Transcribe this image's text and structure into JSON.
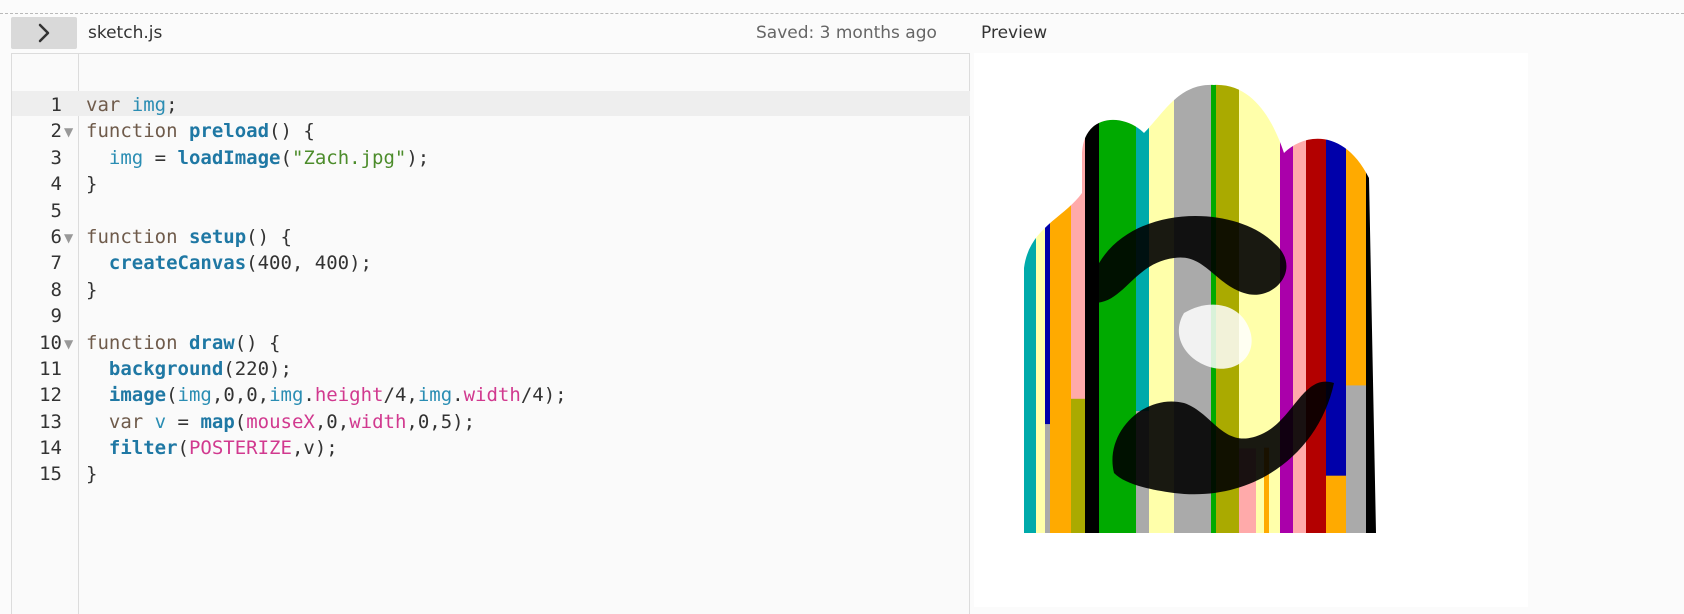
{
  "toolbar": {
    "toggle_icon": "chevron-right-icon",
    "file_name": "sketch.js",
    "saved_status": "Saved: 3 months ago",
    "preview_label": "Preview"
  },
  "colors": {
    "keyword": "#6f5b4b",
    "function_name": "#1f78a4",
    "builtin": "#1f78a4",
    "variable": "#2a8db3",
    "property": "#d1398f",
    "string": "#4c8c2b",
    "plain": "#333333"
  },
  "editor": {
    "lines": [
      {
        "number": "1",
        "fold": false,
        "tokens": [
          {
            "text": "var ",
            "type": "keyword"
          },
          {
            "text": "img",
            "type": "variable"
          },
          {
            "text": ";",
            "type": "plain"
          }
        ]
      },
      {
        "number": "2",
        "fold": true,
        "tokens": [
          {
            "text": "function ",
            "type": "keyword"
          },
          {
            "text": "preload",
            "type": "function_name"
          },
          {
            "text": "() {",
            "type": "plain"
          }
        ]
      },
      {
        "number": "3",
        "fold": false,
        "tokens": [
          {
            "text": "  ",
            "type": "plain"
          },
          {
            "text": "img",
            "type": "variable"
          },
          {
            "text": " = ",
            "type": "plain"
          },
          {
            "text": "loadImage",
            "type": "builtin"
          },
          {
            "text": "(",
            "type": "plain"
          },
          {
            "text": "\"Zach.jpg\"",
            "type": "string"
          },
          {
            "text": ");",
            "type": "plain"
          }
        ]
      },
      {
        "number": "4",
        "fold": false,
        "tokens": [
          {
            "text": "}",
            "type": "plain"
          }
        ]
      },
      {
        "number": "5",
        "fold": false,
        "tokens": []
      },
      {
        "number": "6",
        "fold": true,
        "tokens": [
          {
            "text": "function ",
            "type": "keyword"
          },
          {
            "text": "setup",
            "type": "function_name"
          },
          {
            "text": "() {",
            "type": "plain"
          }
        ]
      },
      {
        "number": "7",
        "fold": false,
        "tokens": [
          {
            "text": "  ",
            "type": "plain"
          },
          {
            "text": "createCanvas",
            "type": "builtin"
          },
          {
            "text": "(400, 400);",
            "type": "plain"
          }
        ]
      },
      {
        "number": "8",
        "fold": false,
        "tokens": [
          {
            "text": "}",
            "type": "plain"
          }
        ]
      },
      {
        "number": "9",
        "fold": false,
        "tokens": []
      },
      {
        "number": "10",
        "fold": true,
        "tokens": [
          {
            "text": "function ",
            "type": "keyword"
          },
          {
            "text": "draw",
            "type": "function_name"
          },
          {
            "text": "() {",
            "type": "plain"
          }
        ]
      },
      {
        "number": "11",
        "fold": false,
        "tokens": [
          {
            "text": "  ",
            "type": "plain"
          },
          {
            "text": "background",
            "type": "builtin"
          },
          {
            "text": "(220);",
            "type": "plain"
          }
        ]
      },
      {
        "number": "12",
        "fold": false,
        "tokens": [
          {
            "text": "  ",
            "type": "plain"
          },
          {
            "text": "image",
            "type": "builtin"
          },
          {
            "text": "(",
            "type": "plain"
          },
          {
            "text": "img",
            "type": "variable"
          },
          {
            "text": ",0,0,",
            "type": "plain"
          },
          {
            "text": "img",
            "type": "variable"
          },
          {
            "text": ".",
            "type": "plain"
          },
          {
            "text": "height",
            "type": "property"
          },
          {
            "text": "/4,",
            "type": "plain"
          },
          {
            "text": "img",
            "type": "variable"
          },
          {
            "text": ".",
            "type": "plain"
          },
          {
            "text": "width",
            "type": "property"
          },
          {
            "text": "/4);",
            "type": "plain"
          }
        ]
      },
      {
        "number": "13",
        "fold": false,
        "tokens": [
          {
            "text": "  ",
            "type": "plain"
          },
          {
            "text": "var ",
            "type": "keyword"
          },
          {
            "text": "v",
            "type": "variable"
          },
          {
            "text": " = ",
            "type": "plain"
          },
          {
            "text": "map",
            "type": "builtin"
          },
          {
            "text": "(",
            "type": "plain"
          },
          {
            "text": "mouseX",
            "type": "property"
          },
          {
            "text": ",0,",
            "type": "plain"
          },
          {
            "text": "width",
            "type": "property"
          },
          {
            "text": ",0,5);",
            "type": "plain"
          }
        ]
      },
      {
        "number": "14",
        "fold": false,
        "tokens": [
          {
            "text": "  ",
            "type": "plain"
          },
          {
            "text": "filter",
            "type": "builtin"
          },
          {
            "text": "(",
            "type": "plain"
          },
          {
            "text": "POSTERIZE",
            "type": "property"
          },
          {
            "text": ",v);",
            "type": "plain"
          }
        ]
      },
      {
        "number": "15",
        "fold": false,
        "tokens": [
          {
            "text": "}",
            "type": "plain"
          }
        ]
      }
    ]
  },
  "preview": {
    "palette": [
      "#ff0000",
      "#b30000",
      "#000000",
      "#ffaaaa",
      "#aaaaaa",
      "#ffffaa",
      "#aaaa00",
      "#00aaaa",
      "#ffaa00",
      "#ffffff",
      "#aa00aa",
      "#0000aa",
      "#00aa00"
    ]
  }
}
